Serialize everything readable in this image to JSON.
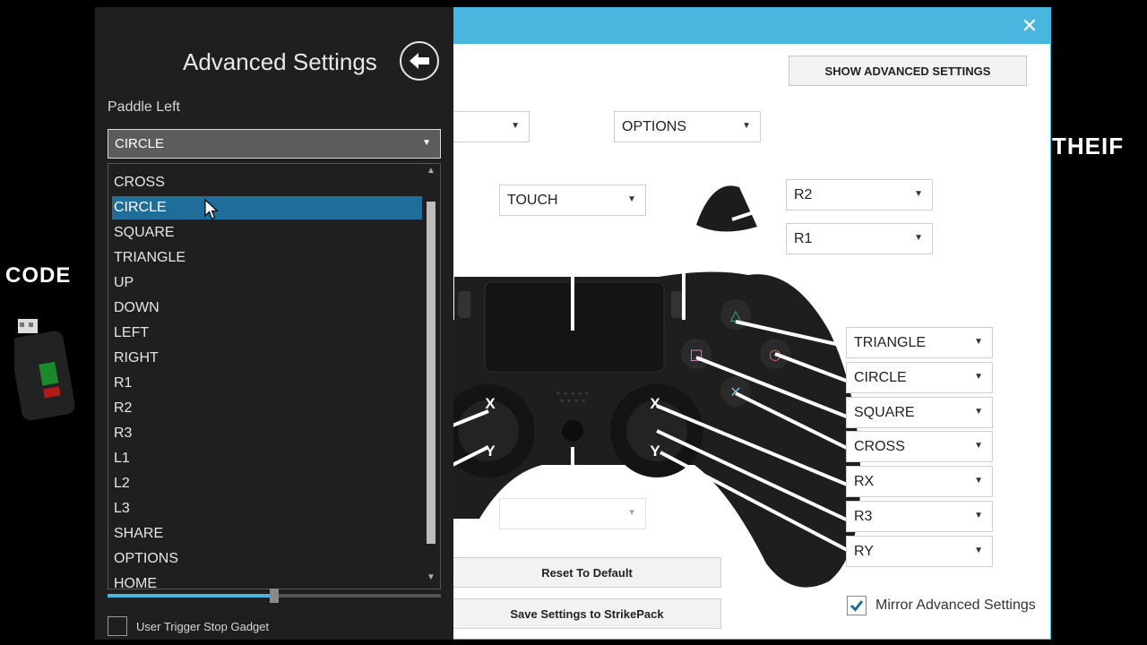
{
  "background": {
    "right_text": "THEIF",
    "left_text": "CODE"
  },
  "panel": {
    "title": "Advanced Settings",
    "paddle_label": "Paddle Left",
    "selected_value": "CIRCLE",
    "options": [
      "CROSS",
      "CIRCLE",
      "SQUARE",
      "TRIANGLE",
      "UP",
      "DOWN",
      "LEFT",
      "RIGHT",
      "R1",
      "R2",
      "R3",
      "L1",
      "L2",
      "L3",
      "SHARE",
      "OPTIONS",
      "HOME"
    ],
    "highlighted_index": 1,
    "user_trigger_label": "User Trigger Stop Gadget",
    "slider_percent": 50
  },
  "main": {
    "show_advanced_label": "SHOW ADVANCED SETTINGS",
    "options_dropdown": "OPTIONS",
    "touch_dropdown": "TOUCH",
    "r2_dropdown": "R2",
    "r1_dropdown": "R1",
    "right_dropdowns": [
      "TRIANGLE",
      "CIRCLE",
      "SQUARE",
      "CROSS",
      "RX",
      "R3",
      "RY"
    ],
    "stick_labels": {
      "x": "X",
      "y": "Y"
    },
    "reset_label": "Reset To Default",
    "save_label": "Save Settings to StrikePack",
    "mirror_label": "Mirror Advanced Settings",
    "mirror_checked": true
  },
  "colors": {
    "accent": "#4ab6e0",
    "selection": "#1e6e99",
    "panel_bg": "#1f1f1f"
  }
}
